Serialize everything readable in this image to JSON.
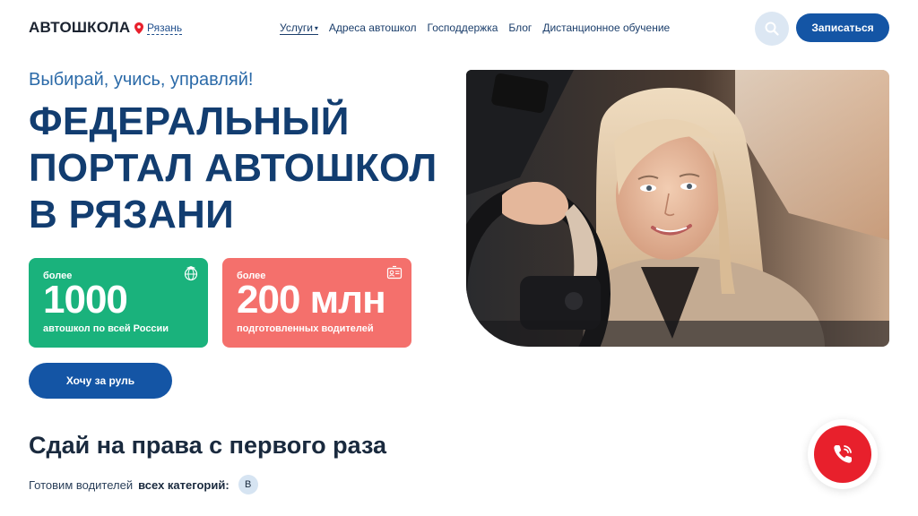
{
  "header": {
    "logo": "АВТОШКОЛА",
    "city": "Рязань",
    "nav": [
      {
        "label": "Услуги",
        "active": true
      },
      {
        "label": "Адреса автошкол"
      },
      {
        "label": "Господдержка"
      },
      {
        "label": "Блог"
      },
      {
        "label": "Дистанционное обучение"
      }
    ],
    "signup_label": "Записаться",
    "search_icon": "search-icon"
  },
  "hero": {
    "tagline": "Выбирай, учись, управляй!",
    "title_lines": [
      "ФЕДЕРАЛЬНЫЙ",
      "ПОРТАЛ АВТОШКОЛ",
      "В РЯЗАНИ"
    ],
    "stats": [
      {
        "pre": "более",
        "value": "1000",
        "sub": "автошкол по всей России",
        "color": "#1ab27c",
        "icon": "globe-cap-icon"
      },
      {
        "pre": "более",
        "value": "200 млн",
        "sub": "подготовленных водителей",
        "color": "#f4706c",
        "icon": "license-icon"
      }
    ],
    "cta_label": "Хочу за руль",
    "photo": "photo-driver"
  },
  "section": {
    "title": "Сдай на права с первого раза",
    "sub_prefix": "Готовим водителей",
    "sub_bold": "всех категорий:",
    "badge": "В"
  },
  "colors": {
    "primary": "#1455a5",
    "title": "#123d70",
    "call": "#e8202c"
  }
}
